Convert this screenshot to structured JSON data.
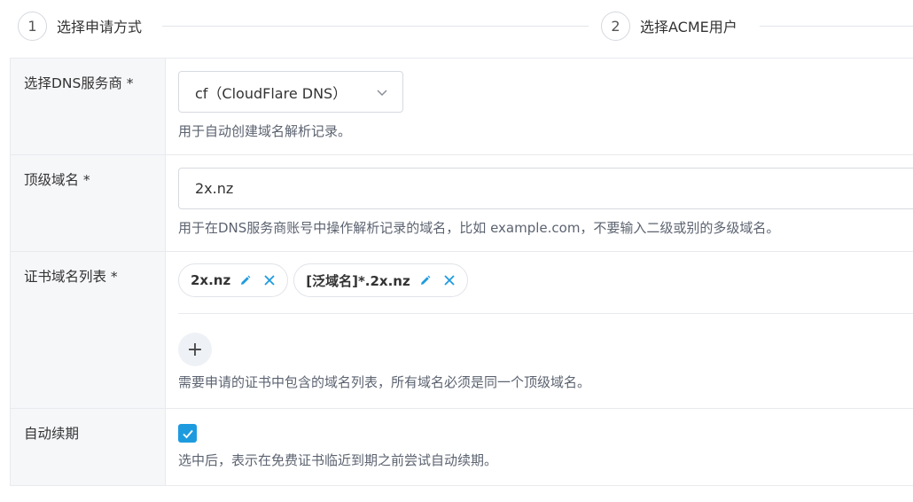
{
  "steps": [
    {
      "number": "1",
      "label": "选择申请方式"
    },
    {
      "number": "2",
      "label": "选择ACME用户"
    }
  ],
  "form": {
    "dns_provider": {
      "label": "选择DNS服务商 *",
      "value": "cf（CloudFlare DNS）",
      "helper": "用于自动创建域名解析记录。"
    },
    "top_domain": {
      "label": "顶级域名 *",
      "value": "2x.nz",
      "helper": "用于在DNS服务商账号中操作解析记录的域名，比如 example.com，不要输入二级或别的多级域名。"
    },
    "domain_list": {
      "label": "证书域名列表 *",
      "tags": [
        "2x.nz",
        "[泛域名]*.2x.nz"
      ],
      "add_label": "+",
      "helper": "需要申请的证书中包含的域名列表，所有域名必须是同一个顶级域名。"
    },
    "auto_renew": {
      "label": "自动续期",
      "checked": true,
      "helper": "选中后，表示在免费证书临近到期之前尝试自动续期。"
    }
  },
  "colors": {
    "accent": "#1e9bdf",
    "label_bg": "#f6f7f9",
    "border": "#e8eaee"
  },
  "icons": [
    "chevron-down-icon",
    "pencil-icon",
    "close-icon",
    "plus-icon",
    "check-icon"
  ]
}
